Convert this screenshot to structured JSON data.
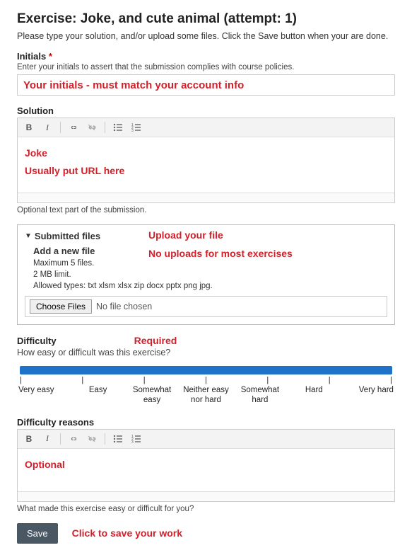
{
  "page": {
    "title": "Exercise: Joke, and cute animal (attempt: 1)",
    "intro": "Please type your solution, and/or upload some files. Click the Save button when your are done."
  },
  "initials": {
    "label": "Initials",
    "required_star": "*",
    "help": "Enter your initials to assert that the submission complies with course policies.",
    "annotation": "Your initials - must match your account info"
  },
  "solution": {
    "label": "Solution",
    "body_line1": "Joke",
    "body_line2": "Usually put URL here",
    "caption": "Optional text part of the submission."
  },
  "toolbar": {
    "bold": "B",
    "italic": "I"
  },
  "files": {
    "header": "Submitted files",
    "add_label": "Add a new file",
    "max": "Maximum 5 files.",
    "limit": "2 MB limit.",
    "allowed": "Allowed types: txt xlsm xlsx zip docx pptx png jpg.",
    "choose_btn": "Choose Files",
    "no_file": "No file chosen",
    "annot1": "Upload your file",
    "annot2": "No uploads for most exercises"
  },
  "difficulty": {
    "label": "Difficulty",
    "required_annot": "Required",
    "help": "How easy or difficult was this exercise?",
    "options": [
      "Very easy",
      "Easy",
      "Somewhat easy",
      "Neither easy nor hard",
      "Somewhat hard",
      "Hard",
      "Very hard"
    ]
  },
  "reasons": {
    "label": "Difficulty reasons",
    "body": "Optional",
    "caption": "What made this exercise easy or difficult for you?"
  },
  "save": {
    "button": "Save",
    "annot": "Click to save your work"
  }
}
